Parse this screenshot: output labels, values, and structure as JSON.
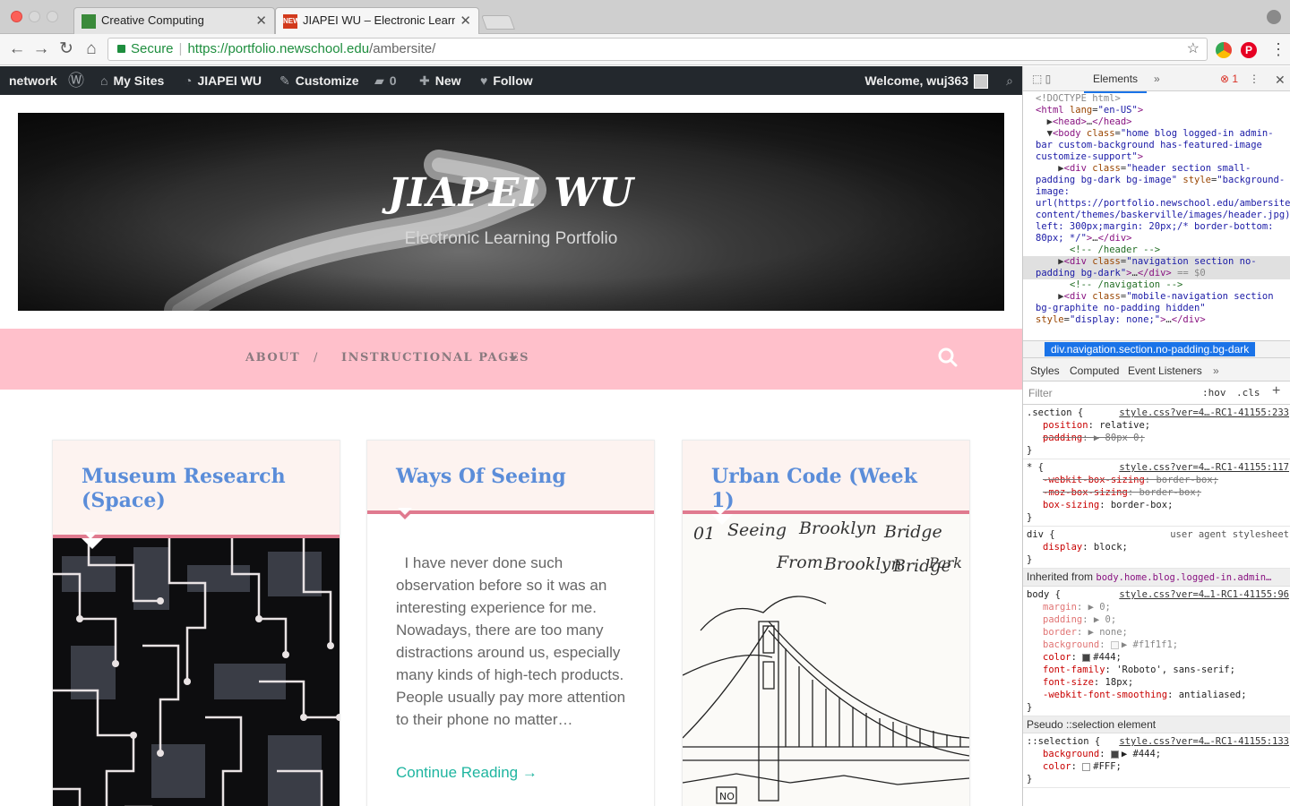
{
  "browser": {
    "tabs": [
      {
        "title": "Creative Computing"
      },
      {
        "title": "JIAPEI WU – Electronic Learnin",
        "favicon_text": "NEW"
      }
    ],
    "url": {
      "secure_label": "Secure",
      "scheme_host": "https://portfolio.newschool.edu",
      "path": "/ambersite/"
    },
    "extension_pinterest": "P"
  },
  "adminbar": {
    "network": "network",
    "my_sites": "My Sites",
    "site_name": "JIAPEI WU",
    "customize": "Customize",
    "comments_count": "0",
    "new": "New",
    "follow": "Follow",
    "welcome": "Welcome, wuj363"
  },
  "header": {
    "title": "JIAPEI WU",
    "description": "Electronic Learning Portfolio"
  },
  "nav": {
    "items": [
      {
        "label": "ABOUT"
      },
      {
        "label": "/"
      },
      {
        "label": "INSTRUCTIONAL PAGES"
      }
    ]
  },
  "posts": [
    {
      "title": "Museum Research (Space)"
    },
    {
      "title": "Ways Of Seeing",
      "excerpt": "  I have never done such observation before so it was an interesting experience for me. Nowadays, there are too many distractions around us, especially many kinds of high-tech products. People usually pay more attention to their phone no matter…",
      "more": "Continue Reading →"
    },
    {
      "title": "Urban Code (Week 1)",
      "sketch_text": [
        "01",
        "Seeing",
        "Brooklyn",
        "Bridge",
        "From",
        "Brooklyn",
        "Bridge",
        "Park",
        "NO"
      ]
    }
  ],
  "devtools": {
    "tab": "Elements",
    "error_count": "1",
    "dom_lines": [
      {
        "html": "<span class='gr'>&lt;!DOCTYPE html&gt;</span>"
      },
      {
        "html": "<span class='tg'>&lt;html</span> <span class='an'>lang</span>=<span class='av'>\"en-US\"</span><span class='tg'>&gt;</span>"
      },
      {
        "html": "  ▶<span class='tg'>&lt;head&gt;</span>…<span class='tg'>&lt;/head&gt;</span>"
      },
      {
        "html": "  ▼<span class='tg'>&lt;body</span> <span class='an'>class</span>=<span class='av'>\"home blog logged-in admin-bar custom-background has-featured-image customize-support\"</span><span class='tg'>&gt;</span>"
      },
      {
        "html": "    ▶<span class='tg'>&lt;div</span> <span class='an'>class</span>=<span class='av'>\"header section small-padding bg-dark bg-image\"</span> <span class='an'>style</span>=<span class='av'>\"background-image: url(https://portfolio.newschool.edu/ambersite/wp-content/themes/baskerville/images/header.jpg);padding-left: 300px;margin: 20px;/* border-bottom: 80px; */\"</span><span class='tg'>&gt;</span>…<span class='tg'>&lt;/div&gt;</span>"
      },
      {
        "html": "      <span class='cm'>&lt;!-- /header --&gt;</span>"
      },
      {
        "html": "    ▶<span class='tg'>&lt;div</span> <span class='an'>class</span>=<span class='av'>\"navigation section no-padding bg-dark\"</span><span class='tg'>&gt;</span>…<span class='tg'>&lt;/div&gt;</span> <span class='gr'>== $0</span>",
        "selected": true
      },
      {
        "html": "      <span class='cm'>&lt;!-- /navigation --&gt;</span>"
      },
      {
        "html": "    ▶<span class='tg'>&lt;div</span> <span class='an'>class</span>=<span class='av'>\"mobile-navigation section bg-graphite no-padding hidden\"</span> <span class='an'>style</span>=<span class='av'>\"display: none;\"</span><span class='tg'>&gt;</span>…<span class='tg'>&lt;/div&gt;</span>"
      }
    ],
    "breadcrumb": "div.navigation.section.no-padding.bg-dark",
    "subtabs": [
      "Styles",
      "Computed",
      "Event Listeners"
    ],
    "filter_placeholder": "Filter",
    "filter_hov": ":hov",
    "filter_cls": ".cls",
    "rules": [
      {
        "selector": ".section {",
        "source": "style.css?ver=4…-RC1-41155:233",
        "props": [
          {
            "name": "position",
            "value": "relative;"
          },
          {
            "name": "padding",
            "value": "▶ 80px 0;",
            "struck": true
          }
        ]
      },
      {
        "selector": "* {",
        "source": "style.css?ver=4…-RC1-41155:117",
        "props": [
          {
            "name": "-webkit-box-sizing",
            "value": "border-box;",
            "struck": true
          },
          {
            "name": "-moz-box-sizing",
            "value": "border-box;",
            "struck": true
          },
          {
            "name": "box-sizing",
            "value": "border-box;"
          }
        ]
      },
      {
        "selector": "div {",
        "source": "user agent stylesheet",
        "ua": true,
        "props": [
          {
            "name": "display",
            "value": "block;"
          }
        ]
      }
    ],
    "inherited_label": "Inherited from",
    "inherited_from": "body.home.blog.logged-in.admin…",
    "body_rule": {
      "selector": "body {",
      "source": "style.css?ver=4…1-RC1-41155:96",
      "props": [
        {
          "name": "margin",
          "value": "▶ 0;",
          "dim": true
        },
        {
          "name": "padding",
          "value": "▶ 0;",
          "dim": true
        },
        {
          "name": "border",
          "value": "▶ none;",
          "dim": true
        },
        {
          "name": "background",
          "value": "▶ #f1f1f1;",
          "dim": true,
          "swatch": "#f1f1f1"
        },
        {
          "name": "color",
          "value": "#444;",
          "swatch": "#444444"
        },
        {
          "name": "font-family",
          "value": "'Roboto', sans-serif;"
        },
        {
          "name": "font-size",
          "value": "18px;"
        },
        {
          "name": "-webkit-font-smoothing",
          "value": "antialiased;"
        }
      ]
    },
    "pseudo_label": "Pseudo ::selection element",
    "selection_rule": {
      "selector": "::selection {",
      "source": "style.css?ver=4…-RC1-41155:133",
      "props": [
        {
          "name": "background",
          "value": "▶ #444;",
          "swatch": "#444444"
        },
        {
          "name": "color",
          "value": "#FFF;",
          "swatch": "#ffffff"
        }
      ]
    }
  },
  "colors": {
    "nav_bg": "#ffc0cb",
    "post_title": "#5b8dd9",
    "accent_border": "#e07a8f",
    "continue_link": "#1fb5a0",
    "adminbar_bg": "#23282d"
  }
}
